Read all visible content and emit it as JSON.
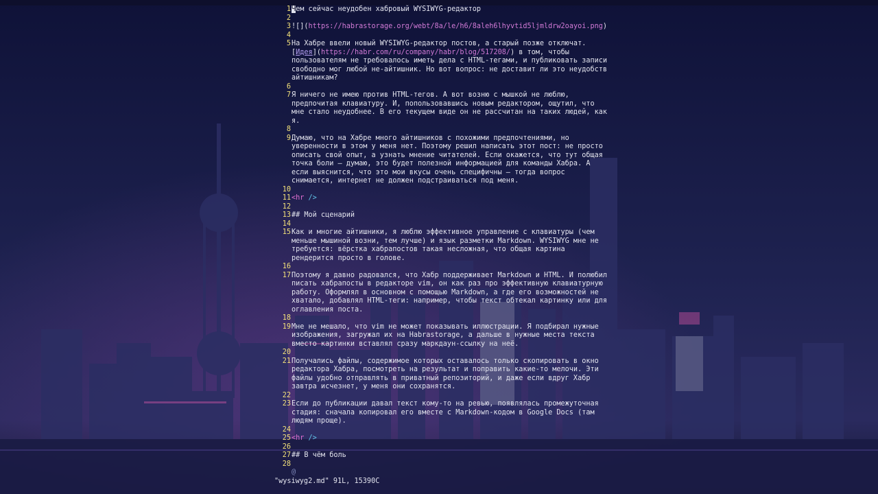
{
  "editor": {
    "lines": [
      {
        "n": "1",
        "rows": [
          "Чем сейчас неудобен хабровый WYSIWYG-редактор"
        ]
      },
      {
        "n": "2",
        "rows": [
          ""
        ]
      },
      {
        "n": "3",
        "rows": [
          "![](https://habrastorage.org/webt/8a/le/h6/8aleh6lhyvtid5ljmldrw2oayoi.png)"
        ]
      },
      {
        "n": "4",
        "rows": [
          ""
        ]
      },
      {
        "n": "5",
        "rows": [
          "На Хабре ввели новый WYSIWYG-редактор постов, а старый позже отключат.",
          "[Идея](https://habr.com/ru/company/habr/blog/517208/) в том, чтобы",
          "пользователям не требовалось иметь дела с HTML-тегами, и публиковать записи",
          "свободно мог любой не-айтишник. Но вот вопрос: не доставит ли это неудобств",
          "айтишникам?"
        ]
      },
      {
        "n": "6",
        "rows": [
          ""
        ]
      },
      {
        "n": "7",
        "rows": [
          "Я ничего не имею против HTML-тегов. А вот возню с мышкой не люблю,",
          "предпочитая клавиатуру. И, попользовавшись новым редактором, ощутил, что",
          "мне стало неудобнее. В его текущем виде он не рассчитан на таких людей, как",
          "я."
        ]
      },
      {
        "n": "8",
        "rows": [
          ""
        ]
      },
      {
        "n": "9",
        "rows": [
          "Думаю, что на Хабре много айтишников с похожими предпочтениями, но",
          "уверенности в этом у меня нет. Поэтому решил написать этот пост: не просто",
          "описать свой опыт, а узнать мнение читателей. Если окажется, что тут общая",
          "точка боли — думаю, это будет полезной информацией для команды Хабра. А",
          "если выяснится, что это мои вкусы очень специфичны — тогда вопрос",
          "снимается, интернет не должен подстраиваться под меня."
        ]
      },
      {
        "n": "10",
        "rows": [
          ""
        ]
      },
      {
        "n": "11",
        "rows": [
          "<hr />"
        ]
      },
      {
        "n": "12",
        "rows": [
          ""
        ]
      },
      {
        "n": "13",
        "rows": [
          "## Мой сценарий"
        ]
      },
      {
        "n": "14",
        "rows": [
          ""
        ]
      },
      {
        "n": "15",
        "rows": [
          "Как и многие айтишники, я люблю эффективное управление с клавиатуры (чем",
          "меньше мышиной возни, тем лучше) и язык разметки Markdown. WYSIWYG мне не",
          "требуется: вёрстка хабрапостов такая несложная, что общая картина",
          "рендерится просто в голове."
        ]
      },
      {
        "n": "16",
        "rows": [
          ""
        ]
      },
      {
        "n": "17",
        "rows": [
          "Поэтому я давно радовался, что Хабр поддерживает Markdown и HTML. И полюбил",
          "писать хабрапосты в редакторе vim, он как раз про эффективную клавиатурную",
          "работу. Оформлял в основном с помощью Markdown, а где его возможностей не",
          "хватало, добавлял HTML-теги: например, чтобы текст обтекал картинку или для",
          "оглавления поста."
        ]
      },
      {
        "n": "18",
        "rows": [
          ""
        ]
      },
      {
        "n": "19",
        "rows": [
          "Мне не мешало, что vim не может показывать иллюстрации. Я подбирал нужные",
          "изображения, загружал их на Habrastorage, а дальше в нужные места текста",
          "вместо картинки вставлял сразу маркдаун-ссылку на неё."
        ]
      },
      {
        "n": "20",
        "rows": [
          ""
        ]
      },
      {
        "n": "21",
        "rows": [
          "Получались файлы, содержимое которых оставалось только скопировать в окно",
          "редактора Хабра, посмотреть на результат и поправить какие-то мелочи. Эти",
          "файлы удобно отправлять в приватный репозиторий, и даже если вдруг Хабр",
          "завтра исчезнет, у меня они сохранятся."
        ]
      },
      {
        "n": "22",
        "rows": [
          ""
        ]
      },
      {
        "n": "23",
        "rows": [
          "Если до публикации давал текст кому-то на ревью, появлялась промежуточная",
          "стадия: сначала копировал его вместе с Markdown-кодом в Google Docs (там",
          "людям проще)."
        ]
      },
      {
        "n": "24",
        "rows": [
          ""
        ]
      },
      {
        "n": "25",
        "rows": [
          "<hr />"
        ]
      },
      {
        "n": "26",
        "rows": [
          ""
        ]
      },
      {
        "n": "27",
        "rows": [
          "## В чём боль"
        ]
      },
      {
        "n": "28",
        "rows": [
          ""
        ]
      }
    ],
    "tilde_marker": "@",
    "hr_open": "<hr ",
    "hr_close": "/>"
  },
  "status": {
    "text": "\"wysiwyg2.md\" 91L, 15390C"
  },
  "colors": {
    "line_number": "#f4e27a",
    "text": "#e3e4ee",
    "link": "#b39ef0",
    "url": "#d17ad6",
    "tag": "#e26fd1",
    "tag_slash": "#61c4e7",
    "background": "#171a3f"
  }
}
